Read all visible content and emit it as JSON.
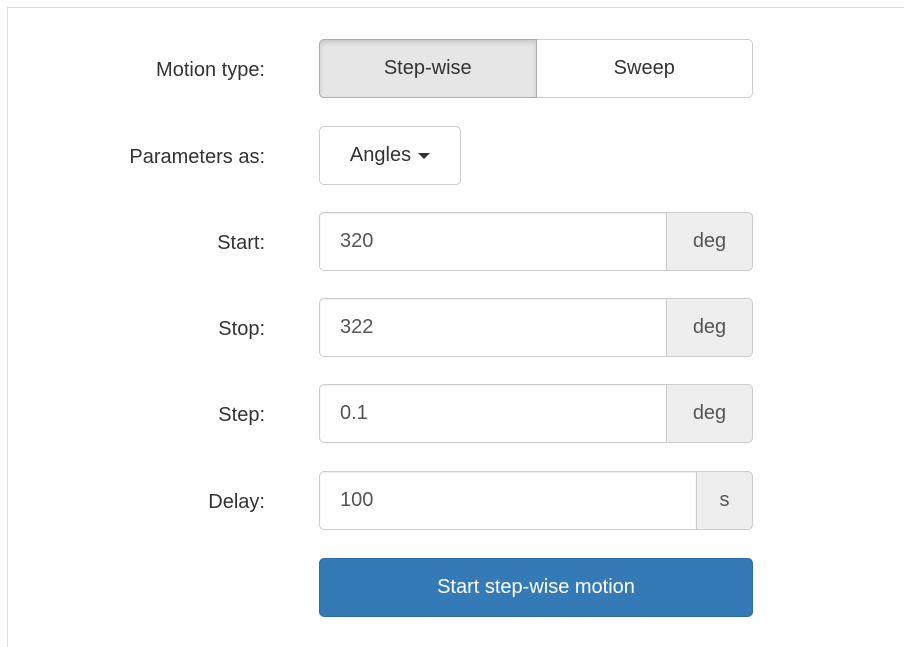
{
  "motion_type": {
    "label": "Motion type:",
    "options": [
      "Step-wise",
      "Sweep"
    ],
    "selected": "Step-wise"
  },
  "parameters_as": {
    "label": "Parameters as:",
    "selected": "Angles",
    "icon": "caret-down-icon"
  },
  "fields": {
    "start": {
      "label": "Start:",
      "value": "320",
      "unit": "deg"
    },
    "stop": {
      "label": "Stop:",
      "value": "322",
      "unit": "deg"
    },
    "step": {
      "label": "Step:",
      "value": "0.1",
      "unit": "deg"
    },
    "delay": {
      "label": "Delay:",
      "value": "100",
      "unit": "s"
    }
  },
  "action": {
    "label": "Start step-wise motion"
  },
  "colors": {
    "primary": "#337ab7",
    "active_segment": "#e6e6e6",
    "addon_bg": "#eeeeee"
  }
}
